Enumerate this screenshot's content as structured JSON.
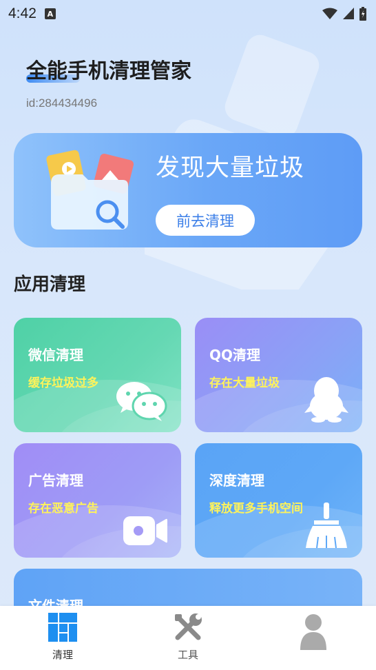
{
  "status_bar": {
    "time": "4:42"
  },
  "header": {
    "title": "全能手机清理管家",
    "user_id": "id:284434496"
  },
  "banner": {
    "heading": "发现大量垃圾",
    "button_label": "前去清理"
  },
  "section": {
    "title": "应用清理"
  },
  "cards": [
    {
      "title": "微信清理",
      "subtitle": "缓存垃圾过多",
      "icon": "wechat-icon"
    },
    {
      "title": "QQ清理",
      "subtitle": "存在大量垃圾",
      "icon": "qq-penguin-icon"
    },
    {
      "title": "广告清理",
      "subtitle": "存在恶意广告",
      "icon": "video-camera-icon"
    },
    {
      "title": "深度清理",
      "subtitle": "释放更多手机空间",
      "icon": "broom-icon"
    },
    {
      "title": "文件清理"
    }
  ],
  "tabbar": {
    "items": [
      {
        "label": "清理",
        "icon": "grid-icon",
        "active": true
      },
      {
        "label": "工具",
        "icon": "tools-icon",
        "active": false
      },
      {
        "label": "",
        "icon": "user-avatar-icon",
        "active": false
      }
    ]
  },
  "colors": {
    "accent": "#3f8cf2",
    "subtitle_yellow": "#fff35a",
    "wechat_card": "#4fd1a6",
    "qq_card": "#9a8ef6",
    "ad_card": "#a08df6",
    "deep_card": "#5aa4f6"
  }
}
